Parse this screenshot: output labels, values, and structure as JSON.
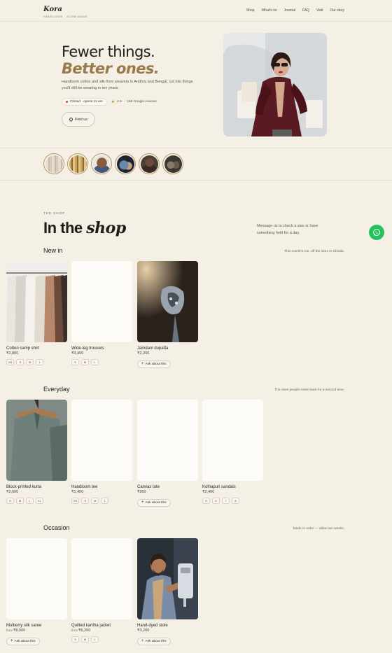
{
  "brand": {
    "name": "Kora",
    "tagline": "HANDLOOM · SLOW MADE"
  },
  "nav": [
    "Shop",
    "What's on",
    "Journal",
    "FAQ",
    "Visit",
    "Our story"
  ],
  "hero": {
    "title_line1": "Fewer things.",
    "title_line2": "Better ones.",
    "description": "Handloom cotton and silk from weavers in Andhra and Bengal, cut into things you'll still be wearing in ten years.",
    "status": "Closed · opens 11 am",
    "rating": "4.9",
    "reviews": "168 Google reviews",
    "find_us": "Find us"
  },
  "shop": {
    "eyebrow": "THE SHOP",
    "title_plain": "In the ",
    "title_italic": "shop",
    "note": "Message us to check a size or have something held for a day."
  },
  "sections": [
    {
      "title": "New in",
      "note": "This month's run, off the loom in Chirala.",
      "products": [
        {
          "name": "Cotton camp shirt",
          "price": "₹2,800",
          "from": "",
          "sizes": [
            "XS",
            "S",
            "M",
            "L"
          ],
          "ask": ""
        },
        {
          "name": "Wide-leg trousers",
          "price": "₹3,400",
          "from": "",
          "sizes": [
            "S",
            "M",
            "L"
          ],
          "ask": ""
        },
        {
          "name": "Jamdani dupatta",
          "price": "₹2,200",
          "from": "",
          "sizes": [],
          "ask": "Ask about this"
        }
      ]
    },
    {
      "title": "Everyday",
      "note": "The ones people come back for a second time.",
      "products": [
        {
          "name": "Block-printed kurta",
          "price": "₹2,600",
          "from": "",
          "sizes": [
            "S",
            "M",
            "L",
            "XL"
          ],
          "ask": ""
        },
        {
          "name": "Handloom tee",
          "price": "₹1,400",
          "from": "",
          "sizes": [
            "XS",
            "S",
            "M",
            "L"
          ],
          "ask": ""
        },
        {
          "name": "Canvas tote",
          "price": "₹950",
          "from": "",
          "sizes": [],
          "ask": "Ask about this"
        },
        {
          "name": "Kolhapuri sandals",
          "price": "₹2,400",
          "from": "",
          "sizes": [
            "5",
            "6",
            "7",
            "8"
          ],
          "ask": ""
        }
      ]
    },
    {
      "title": "Occasion",
      "note": "Made to order — allow two weeks.",
      "products": [
        {
          "name": "Mulberry silk saree",
          "price": "₹8,500",
          "from": "from",
          "sizes": [],
          "ask": "Ask about this"
        },
        {
          "name": "Quilted kantha jacket",
          "price": "₹6,200",
          "from": "from",
          "sizes": [
            "S",
            "M",
            "L"
          ],
          "ask": ""
        },
        {
          "name": "Hand-dyed stole",
          "price": "₹3,200",
          "from": "",
          "sizes": [],
          "ask": "Ask about this"
        }
      ]
    }
  ]
}
